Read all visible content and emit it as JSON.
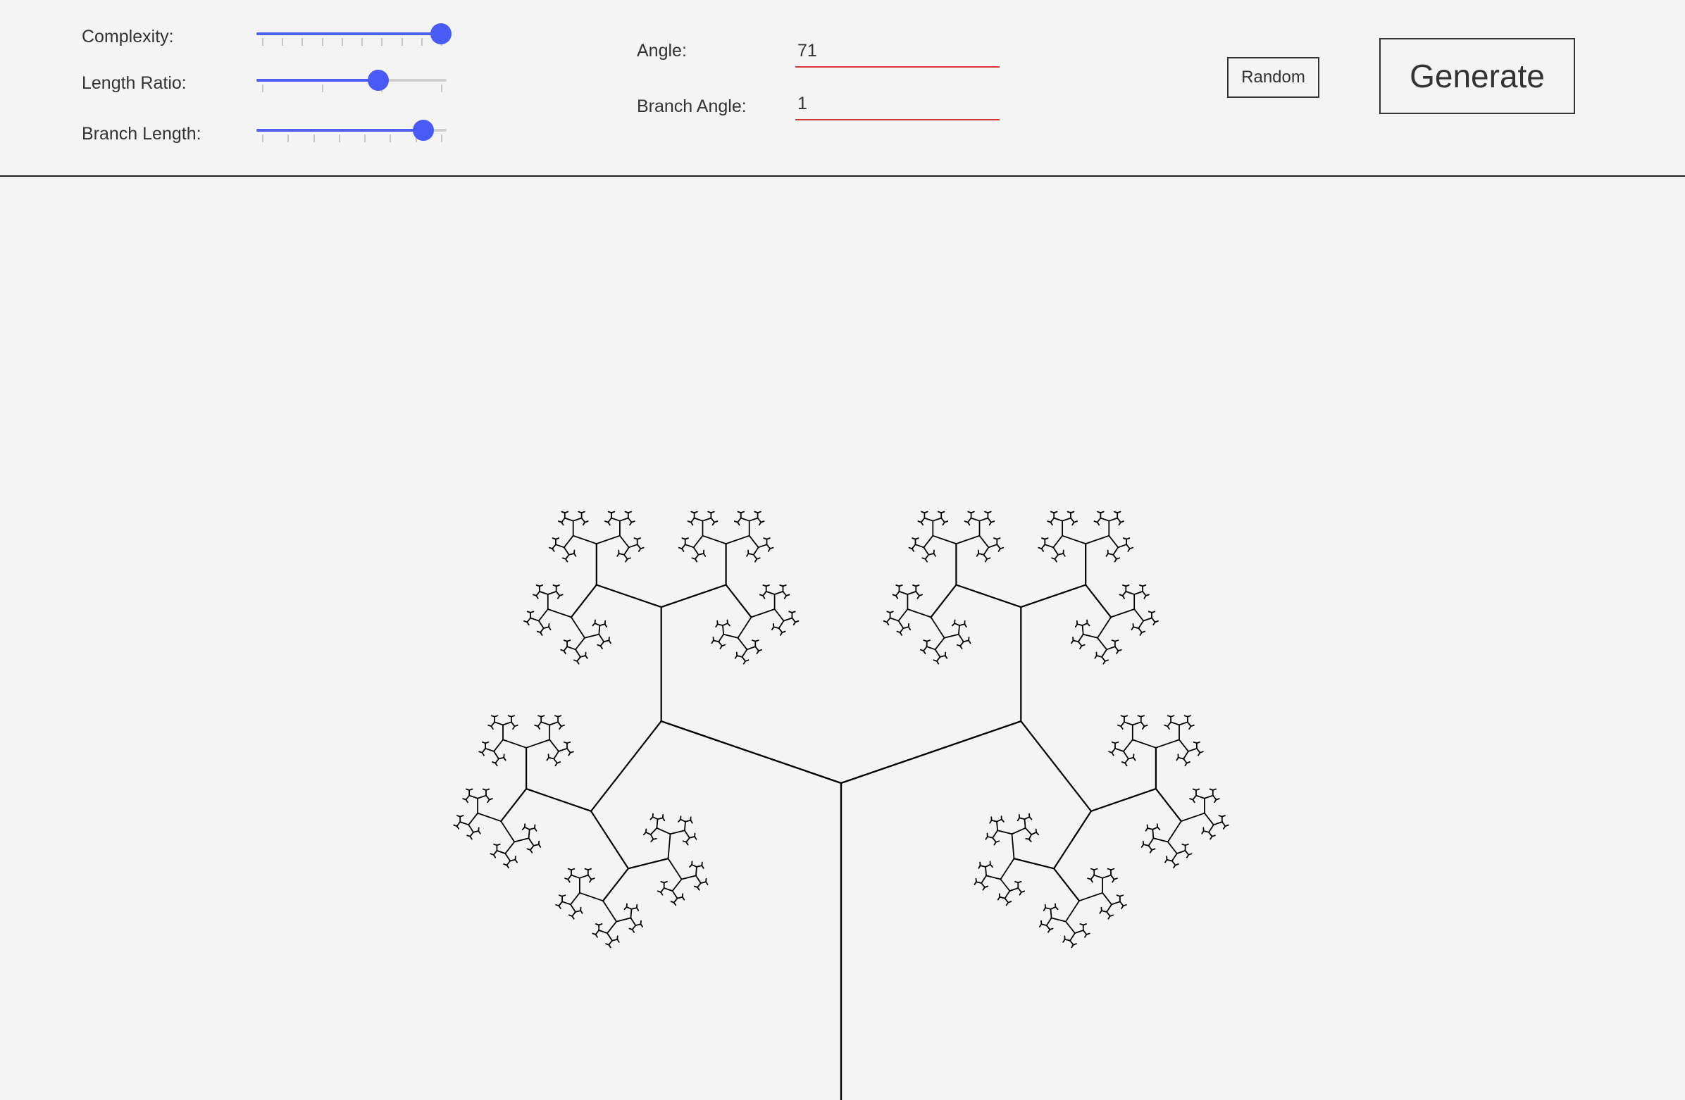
{
  "controls": {
    "complexity": {
      "label": "Complexity:",
      "value": 1.0,
      "ticks": 10
    },
    "length_ratio": {
      "label": "Length Ratio:",
      "value": 0.65,
      "ticks": 4
    },
    "branch_length": {
      "label": "Branch Length:",
      "value": 0.9,
      "ticks": 8
    },
    "angle": {
      "label": "Angle:",
      "value": "71"
    },
    "branch_angle": {
      "label": "Branch Angle:",
      "value": "1"
    },
    "random_label": "Random",
    "generate_label": "Generate"
  },
  "colors": {
    "slider_accent": "#4a5af5",
    "field_underline": "#d23a3a",
    "tree_stroke": "#000000",
    "background": "#f4f4f4"
  }
}
